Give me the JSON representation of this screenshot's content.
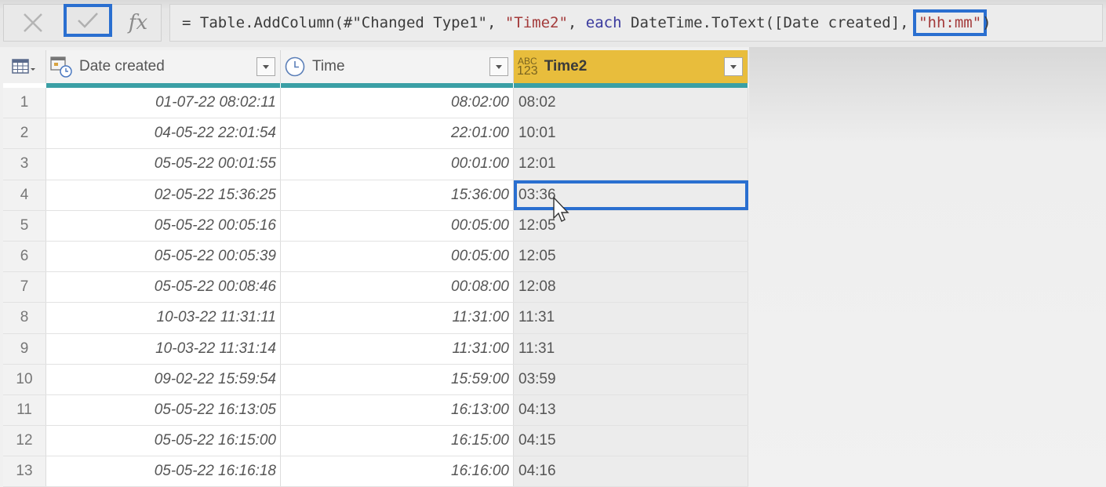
{
  "formula_bar": {
    "cancel_icon": "close-icon",
    "commit_icon": "checkmark-icon",
    "fx_label": "fx",
    "formula_parts": [
      {
        "text": "= Table.AddColumn(#",
        "kind": "plain"
      },
      {
        "text": "\"Changed Type1\"",
        "kind": "plain"
      },
      {
        "text": ", ",
        "kind": "plain"
      },
      {
        "text": "\"Time2\"",
        "kind": "string"
      },
      {
        "text": ", ",
        "kind": "plain"
      },
      {
        "text": "each",
        "kind": "keyword"
      },
      {
        "text": " DateTime.ToText([Date created], ",
        "kind": "plain"
      },
      {
        "text": "\"hh:mm\"",
        "kind": "string-highlight"
      },
      {
        "text": ")",
        "kind": "plain"
      }
    ]
  },
  "table": {
    "columns": [
      {
        "label": "Date created",
        "type_icon": "datetime-icon"
      },
      {
        "label": "Time",
        "type_icon": "clock-icon"
      },
      {
        "label": "Time2",
        "type_icon": "abc-123-icon",
        "type_top": "ABC",
        "type_bottom": "123"
      }
    ],
    "selected_row_index": 4,
    "rows": [
      {
        "n": "1",
        "date": "01-07-22 08:02:11",
        "time": "08:02:00",
        "time2": "08:02"
      },
      {
        "n": "2",
        "date": "04-05-22 22:01:54",
        "time": "22:01:00",
        "time2": "10:01"
      },
      {
        "n": "3",
        "date": "05-05-22 00:01:55",
        "time": "00:01:00",
        "time2": "12:01"
      },
      {
        "n": "4",
        "date": "02-05-22 15:36:25",
        "time": "15:36:00",
        "time2": "03:36"
      },
      {
        "n": "5",
        "date": "05-05-22 00:05:16",
        "time": "00:05:00",
        "time2": "12:05"
      },
      {
        "n": "6",
        "date": "05-05-22 00:05:39",
        "time": "00:05:00",
        "time2": "12:05"
      },
      {
        "n": "7",
        "date": "05-05-22 00:08:46",
        "time": "00:08:00",
        "time2": "12:08"
      },
      {
        "n": "8",
        "date": "10-03-22 11:31:11",
        "time": "11:31:00",
        "time2": "11:31"
      },
      {
        "n": "9",
        "date": "10-03-22 11:31:14",
        "time": "11:31:00",
        "time2": "11:31"
      },
      {
        "n": "10",
        "date": "09-02-22 15:59:54",
        "time": "15:59:00",
        "time2": "03:59"
      },
      {
        "n": "11",
        "date": "05-05-22 16:13:05",
        "time": "16:13:00",
        "time2": "04:13"
      },
      {
        "n": "12",
        "date": "05-05-22 16:15:00",
        "time": "16:15:00",
        "time2": "04:15"
      },
      {
        "n": "13",
        "date": "05-05-22 16:16:18",
        "time": "16:16:00",
        "time2": "04:16"
      }
    ]
  },
  "colors": {
    "selection_blue": "#2a6fd0",
    "header_accent_gold": "#e8bd3c",
    "column_quality_teal": "#3a9fa5",
    "string_red": "#a33a3a",
    "keyword_blue": "#3a3a9e"
  }
}
